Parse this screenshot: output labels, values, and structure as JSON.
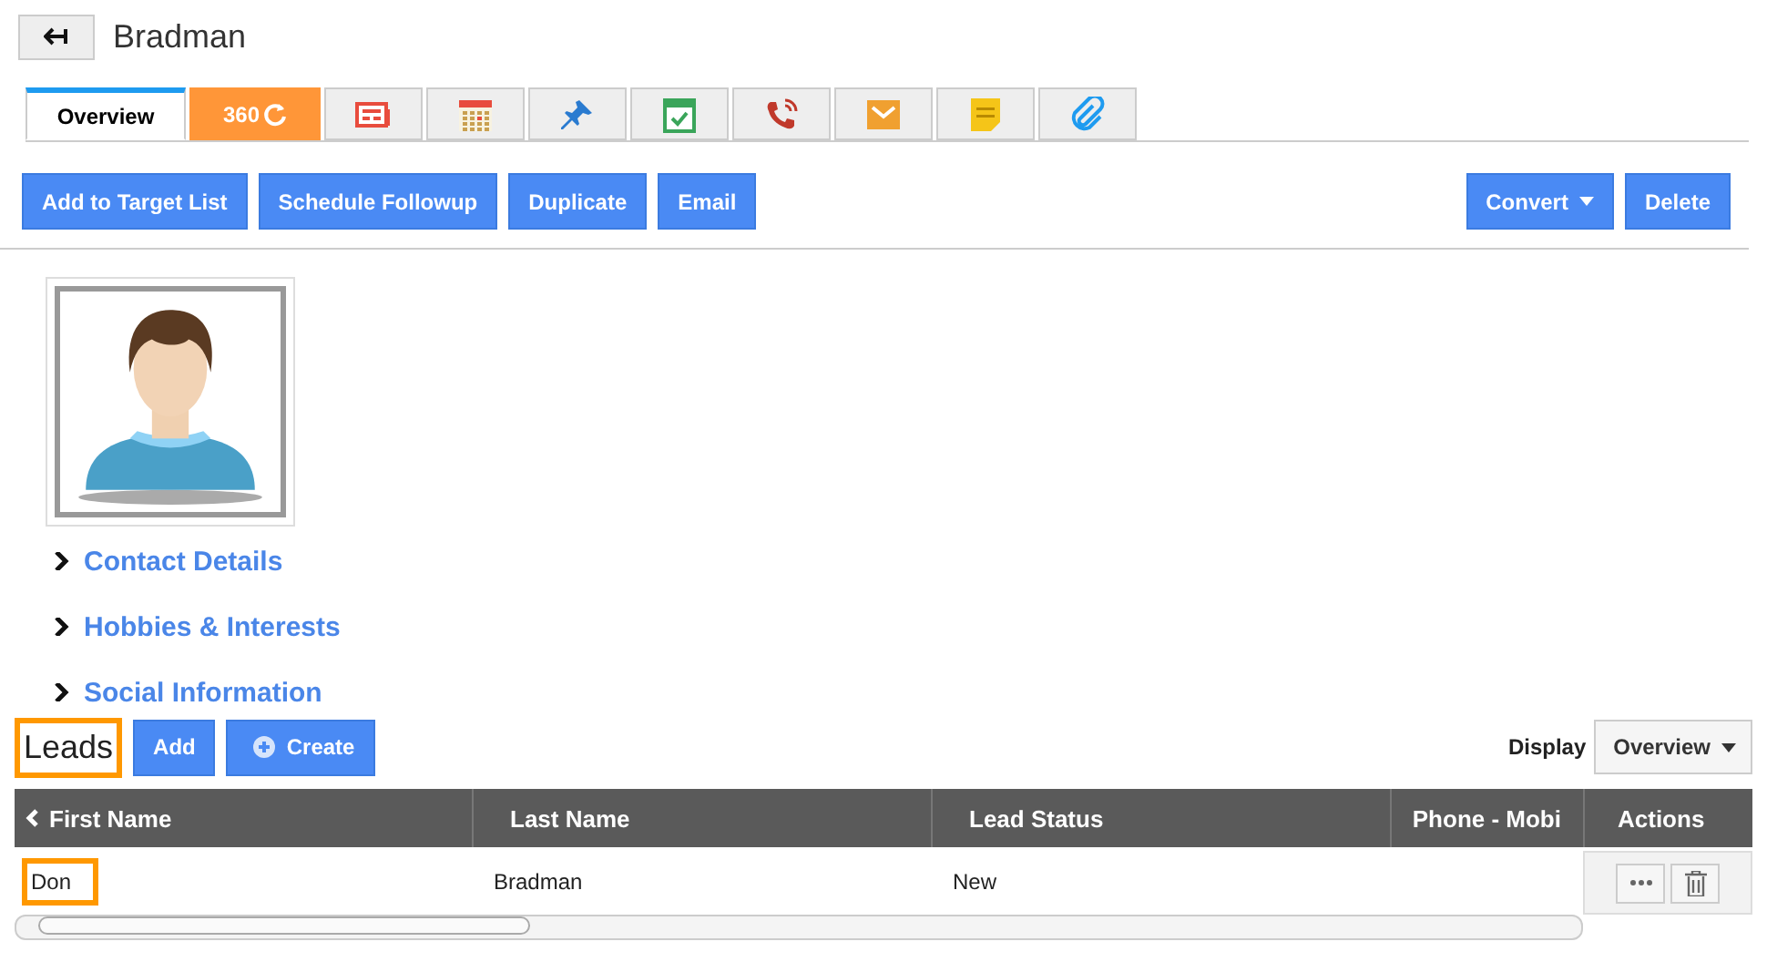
{
  "header": {
    "title": "Bradman"
  },
  "tabs": [
    {
      "kind": "label",
      "label": "Overview",
      "selected": true
    },
    {
      "kind": "brand",
      "label": "360",
      "selected": false
    },
    {
      "kind": "notes",
      "selected": false
    },
    {
      "kind": "calendar",
      "selected": false
    },
    {
      "kind": "pin",
      "selected": false
    },
    {
      "kind": "task",
      "selected": false
    },
    {
      "kind": "call",
      "selected": false
    },
    {
      "kind": "mail",
      "selected": false
    },
    {
      "kind": "memo",
      "selected": false
    },
    {
      "kind": "attachment",
      "selected": false
    }
  ],
  "actions": {
    "left": [
      "Add to Target List",
      "Schedule Followup",
      "Duplicate",
      "Email"
    ],
    "convert": "Convert",
    "delete": "Delete"
  },
  "sections": [
    {
      "label": "Contact Details",
      "expanded": false
    },
    {
      "label": "Hobbies & Interests",
      "expanded": false
    },
    {
      "label": "Social Information",
      "expanded": false
    }
  ],
  "leads": {
    "title": "Leads",
    "title_highlighted": true,
    "add": "Add",
    "create": "Create",
    "display_label": "Display",
    "display_value": "Overview",
    "columns": [
      "First Name",
      "Last Name",
      "Lead Status",
      "Phone - Mobi"
    ],
    "actions_column": "Actions",
    "rows": [
      {
        "cells": [
          {
            "text": "Don",
            "highlighted": true
          },
          {
            "text": "Bradman",
            "highlighted": false
          },
          {
            "text": "New",
            "highlighted": false
          }
        ]
      }
    ]
  }
}
